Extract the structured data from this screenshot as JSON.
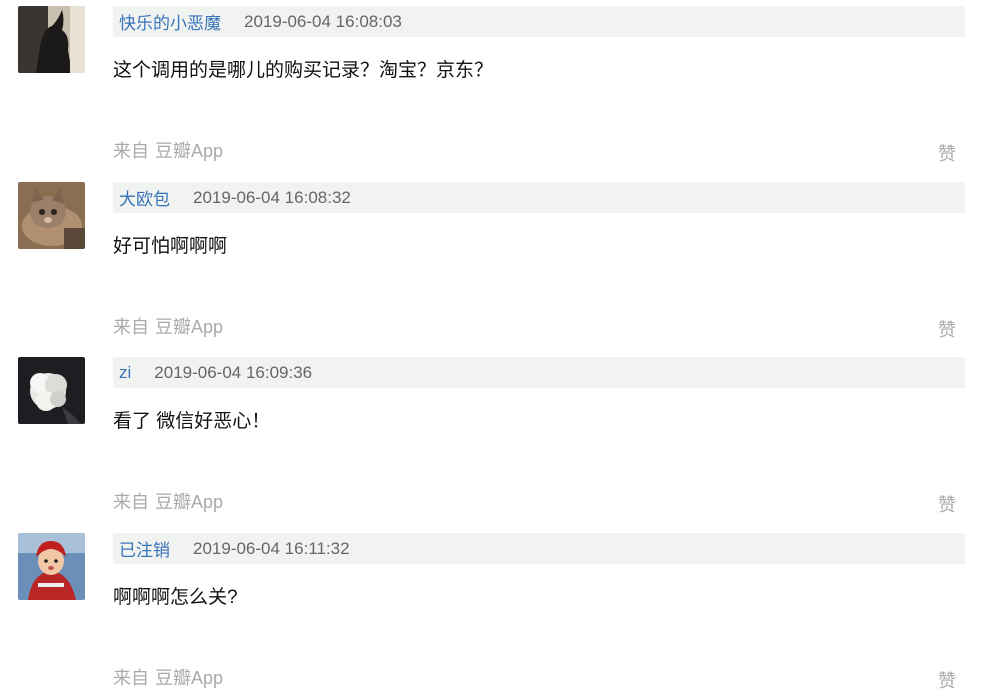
{
  "comments": [
    {
      "author": "快乐的小恶魔",
      "timestamp": "2019-06-04 16:08:03",
      "text": "这个调用的是哪儿的购买记录？淘宝？京东？",
      "source_prefix": "来自",
      "source_app": "豆瓣App",
      "like_label": "赞",
      "avatar_icon": "shadow-silhouette-avatar"
    },
    {
      "author": "大欧包",
      "timestamp": "2019-06-04 16:08:32",
      "text": "好可怕啊啊啊",
      "source_prefix": "来自",
      "source_app": "豆瓣App",
      "like_label": "赞",
      "avatar_icon": "kitten-avatar"
    },
    {
      "author": "zi",
      "timestamp": "2019-06-04 16:09:36",
      "text": "看了 微信好恶心！",
      "source_prefix": "来自",
      "source_app": "豆瓣App",
      "like_label": "赞",
      "avatar_icon": "white-flower-avatar"
    },
    {
      "author": "已注销",
      "timestamp": "2019-06-04 16:11:32",
      "text": "啊啊啊怎么关?",
      "source_prefix": "来自",
      "source_app": "豆瓣App",
      "like_label": "赞",
      "avatar_icon": "child-portrait-avatar"
    }
  ],
  "colors": {
    "author_link": "#3773b8",
    "meta_bar_bg": "#f0f3f0",
    "muted_text": "#aaaaaa"
  }
}
